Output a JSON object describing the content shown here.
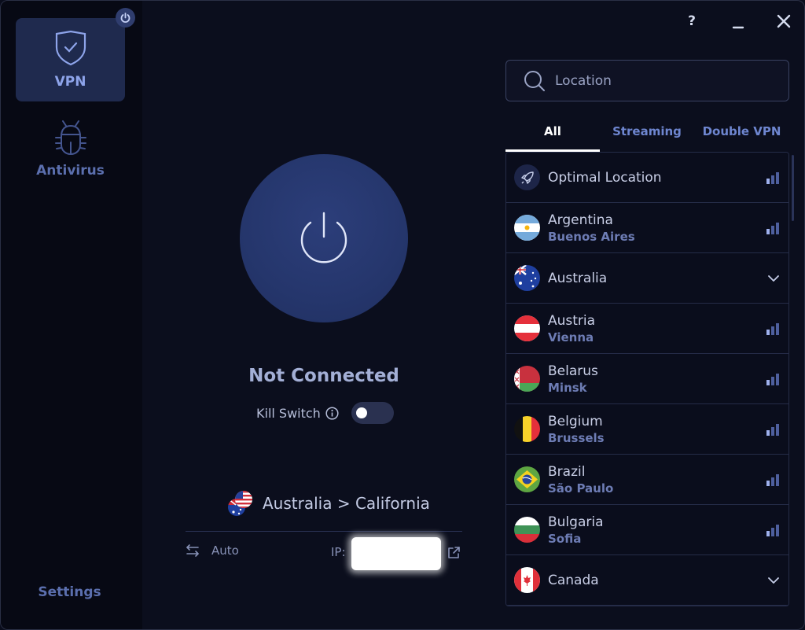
{
  "window_controls": {
    "help": "?",
    "minimize": "minimize",
    "close": "close"
  },
  "sidebar": {
    "items": [
      {
        "label": "VPN",
        "icon": "shield-check-icon",
        "active": true
      },
      {
        "label": "Antivirus",
        "icon": "bug-icon",
        "active": false
      }
    ],
    "settings_label": "Settings",
    "power_badge": "power-icon"
  },
  "main": {
    "status": "Not Connected",
    "kill_switch": {
      "label": "Kill Switch",
      "enabled": false
    },
    "route": "Australia > California",
    "protocol": "Auto",
    "ip_label": "IP:",
    "ip_value": ""
  },
  "locations": {
    "search_placeholder": "Location",
    "search_value": "",
    "tabs": [
      {
        "label": "All",
        "active": true
      },
      {
        "label": "Streaming",
        "active": false
      },
      {
        "label": "Double VPN",
        "active": false
      }
    ],
    "rows": [
      {
        "country": "Optimal Location",
        "city": "",
        "flag": "rocket",
        "action": "signal",
        "signal_level": 1
      },
      {
        "country": "Argentina",
        "city": "Buenos Aires",
        "flag": "ar",
        "action": "signal",
        "signal_level": 1
      },
      {
        "country": "Australia",
        "city": "",
        "flag": "au",
        "action": "expand"
      },
      {
        "country": "Austria",
        "city": "Vienna",
        "flag": "at",
        "action": "signal",
        "signal_level": 1
      },
      {
        "country": "Belarus",
        "city": "Minsk",
        "flag": "by",
        "action": "signal",
        "signal_level": 1
      },
      {
        "country": "Belgium",
        "city": "Brussels",
        "flag": "be",
        "action": "signal",
        "signal_level": 1
      },
      {
        "country": "Brazil",
        "city": "São Paulo",
        "flag": "br",
        "action": "signal",
        "signal_level": 1
      },
      {
        "country": "Bulgaria",
        "city": "Sofia",
        "flag": "bg",
        "action": "signal",
        "signal_level": 1
      },
      {
        "country": "Canada",
        "city": "",
        "flag": "ca",
        "action": "expand"
      }
    ]
  },
  "colors": {
    "accent": "#8ea4ea",
    "power_button": "#25366c",
    "background": "#0b0e1d",
    "sidebar": "#070914"
  }
}
